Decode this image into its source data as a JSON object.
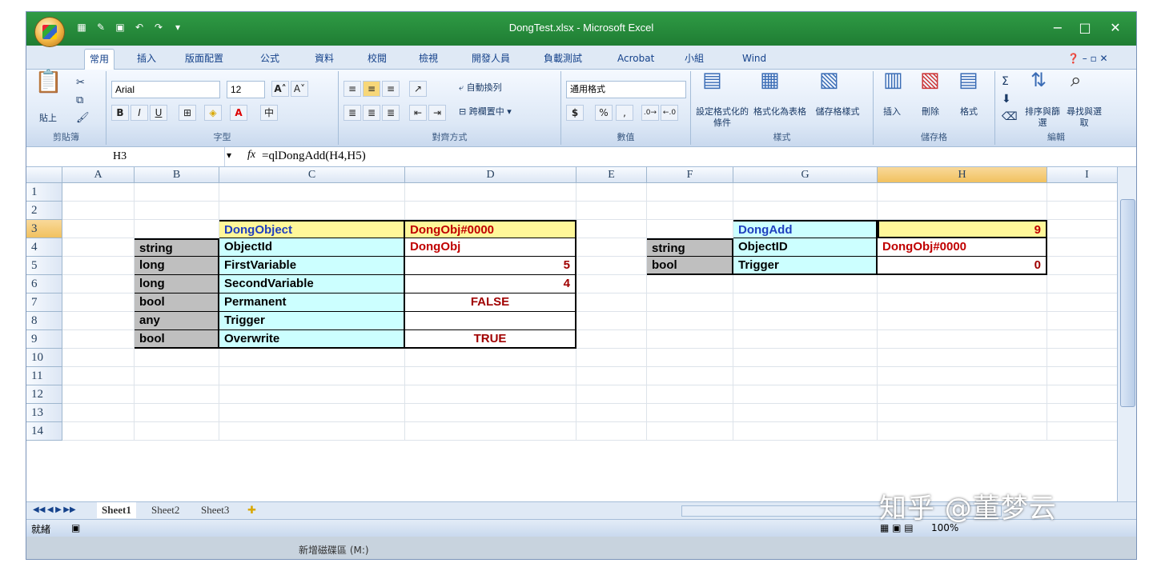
{
  "window": {
    "title": "DongTest.xlsx - Microsoft Excel"
  },
  "tabs": [
    "常用",
    "插入",
    "版面配置",
    "公式",
    "資料",
    "校閱",
    "檢視",
    "開發人員",
    "負載測試",
    "Acrobat",
    "小組",
    "Wind"
  ],
  "ribbon": {
    "clipboard": {
      "paste": "貼上",
      "label": "剪貼簿"
    },
    "font": {
      "name": "Arial",
      "size": "12",
      "label": "字型"
    },
    "alignment": {
      "wrap": "自動換列",
      "merge": "跨欄置中",
      "label": "對齊方式"
    },
    "number": {
      "format": "通用格式",
      "label": "數值",
      "currency": "$",
      "percent": "%",
      "comma": ","
    },
    "styles": {
      "cond": "設定格式化的條件",
      "table": "格式化為表格",
      "cell": "儲存格樣式",
      "label": "樣式"
    },
    "cells": {
      "insert": "插入",
      "delete": "刪除",
      "format": "格式",
      "label": "儲存格"
    },
    "editing": {
      "sort": "排序與篩選",
      "find": "尋找與選取",
      "label": "編輯"
    }
  },
  "formula_bar": {
    "name_box": "H3",
    "fx": "fx",
    "formula": "=qlDongAdd(H4,H5)"
  },
  "columns": [
    "A",
    "B",
    "C",
    "D",
    "E",
    "F",
    "G",
    "H",
    "I"
  ],
  "rows": [
    "1",
    "2",
    "3",
    "4",
    "5",
    "6",
    "7",
    "8",
    "9",
    "10",
    "11",
    "12",
    "13",
    "14"
  ],
  "cells": {
    "C3": "DongObject",
    "D3": "DongObj#0000",
    "B4": "string",
    "C4": "ObjectId",
    "D4": "DongObj",
    "B5": "long",
    "C5": "FirstVariable",
    "D5": "5",
    "B6": "long",
    "C6": "SecondVariable",
    "D6": "4",
    "B7": "bool",
    "C7": "Permanent",
    "D7": "FALSE",
    "B8": "any",
    "C8": "Trigger",
    "D8": "",
    "B9": "bool",
    "C9": "Overwrite",
    "D9": "TRUE",
    "G3": "DongAdd",
    "H3": "9",
    "F4": "string",
    "G4": "ObjectID",
    "H4": "DongObj#0000",
    "F5": "bool",
    "G5": "Trigger",
    "H5": "0"
  },
  "sheets": [
    "Sheet1",
    "Sheet2",
    "Sheet3"
  ],
  "status": {
    "ready": "就緒",
    "zoom": "100%"
  },
  "taskbar": {
    "item": "新增磁碟區 (M:)"
  },
  "watermark": "知乎 @董梦云"
}
